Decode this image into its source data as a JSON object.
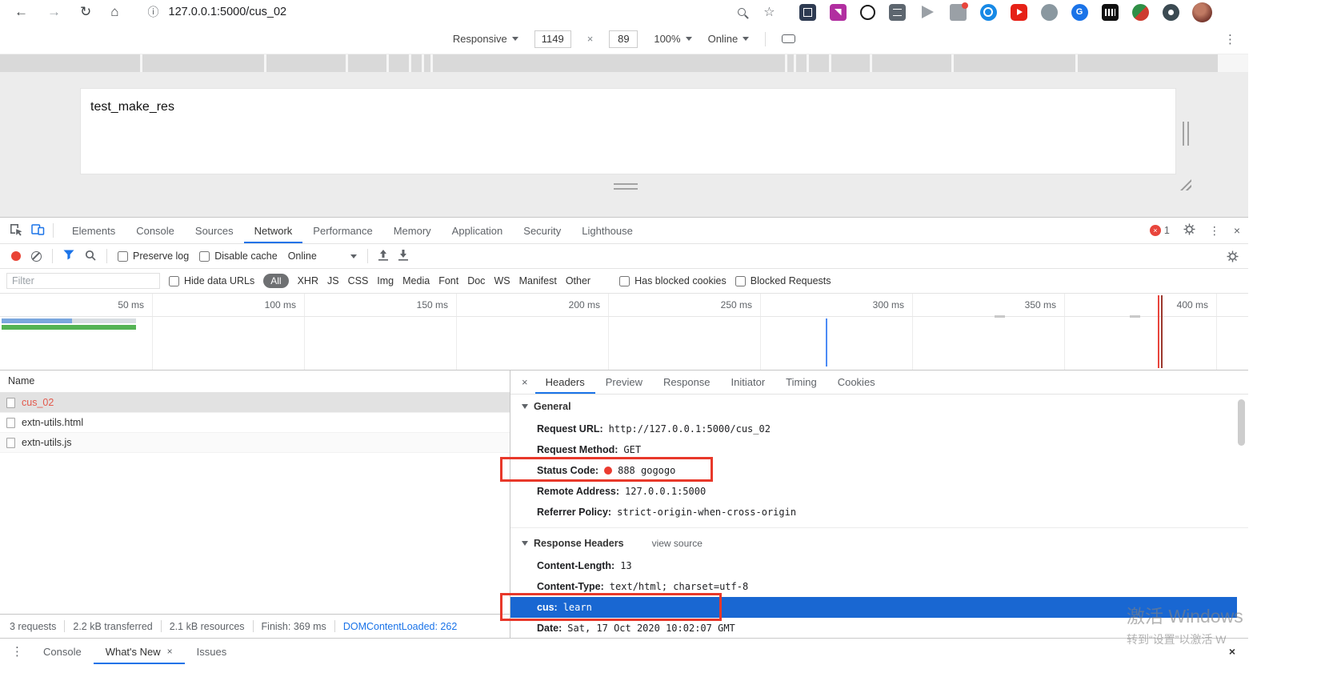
{
  "browser": {
    "url": "127.0.0.1:5000/cus_02",
    "nav": {
      "back": "←",
      "forward": "→",
      "reload": "↻",
      "home": "⌂",
      "info": "ⓘ",
      "star": "☆"
    },
    "device_toolbar": {
      "device": "Responsive",
      "width": "1149",
      "separator": "×",
      "height": "89",
      "zoom": "100%",
      "throttle": "Online",
      "menu": "⋮"
    }
  },
  "page": {
    "content": "test_make_res"
  },
  "devtools": {
    "tabs": [
      "Elements",
      "Console",
      "Sources",
      "Network",
      "Performance",
      "Memory",
      "Application",
      "Security",
      "Lighthouse"
    ],
    "active_tab": "Network",
    "error_badge": {
      "icon": "×",
      "count": "1"
    },
    "menu": "⋮",
    "close": "×",
    "toolbar": {
      "preserve_log": "Preserve log",
      "disable_cache": "Disable cache",
      "throttle": "Online"
    },
    "filter": {
      "placeholder": "Filter",
      "hide_data_urls": "Hide data URLs",
      "types": [
        "All",
        "XHR",
        "JS",
        "CSS",
        "Img",
        "Media",
        "Font",
        "Doc",
        "WS",
        "Manifest",
        "Other"
      ],
      "active_type": "All",
      "has_blocked_cookies": "Has blocked cookies",
      "blocked_requests": "Blocked Requests"
    },
    "timeline": {
      "ticks": [
        "50 ms",
        "100 ms",
        "150 ms",
        "200 ms",
        "250 ms",
        "300 ms",
        "350 ms",
        "400 ms"
      ]
    },
    "requests": {
      "header": "Name",
      "rows": [
        {
          "name": "cus_02",
          "selected": true,
          "error": true
        },
        {
          "name": "extn-utils.html"
        },
        {
          "name": "extn-utils.js"
        }
      ]
    },
    "details": {
      "close": "×",
      "tabs": [
        "Headers",
        "Preview",
        "Response",
        "Initiator",
        "Timing",
        "Cookies"
      ],
      "active_tab": "Headers",
      "general_title": "General",
      "general": [
        {
          "key": "Request URL:",
          "value": "http://127.0.0.1:5000/cus_02"
        },
        {
          "key": "Request Method:",
          "value": "GET"
        },
        {
          "key": "Status Code:",
          "value": "888 gogogo"
        },
        {
          "key": "Remote Address:",
          "value": "127.0.0.1:5000"
        },
        {
          "key": "Referrer Policy:",
          "value": "strict-origin-when-cross-origin"
        }
      ],
      "response_headers_title": "Response Headers",
      "view_source": "view source",
      "response_headers": [
        {
          "key": "Content-Length:",
          "value": "13"
        },
        {
          "key": "Content-Type:",
          "value": "text/html; charset=utf-8"
        },
        {
          "key": "cus:",
          "value": "learn",
          "highlighted": true
        },
        {
          "key": "Date:",
          "value": "Sat, 17 Oct 2020 10:02:07 GMT"
        }
      ]
    },
    "status_bar": {
      "requests": "3 requests",
      "transferred": "2.2 kB transferred",
      "resources": "2.1 kB resources",
      "finish": "Finish: 369 ms",
      "dcl": "DOMContentLoaded: 262"
    },
    "drawer": {
      "menu": "⋮",
      "tabs": [
        "Console",
        "What's New",
        "Issues"
      ],
      "active": "What's New",
      "tab_close": "×",
      "close": "×"
    }
  },
  "watermark": {
    "line1": "激活 Windows",
    "line2": "转到“设置”以激活 W"
  },
  "colors": {
    "accent_blue": "#1a73e8",
    "record_red": "#e94335",
    "error_text_red": "#e3594c",
    "annotation_red": "#e8382a",
    "selected_header_bg": "#1967d2",
    "status_dot_red": "#eb3b30"
  }
}
